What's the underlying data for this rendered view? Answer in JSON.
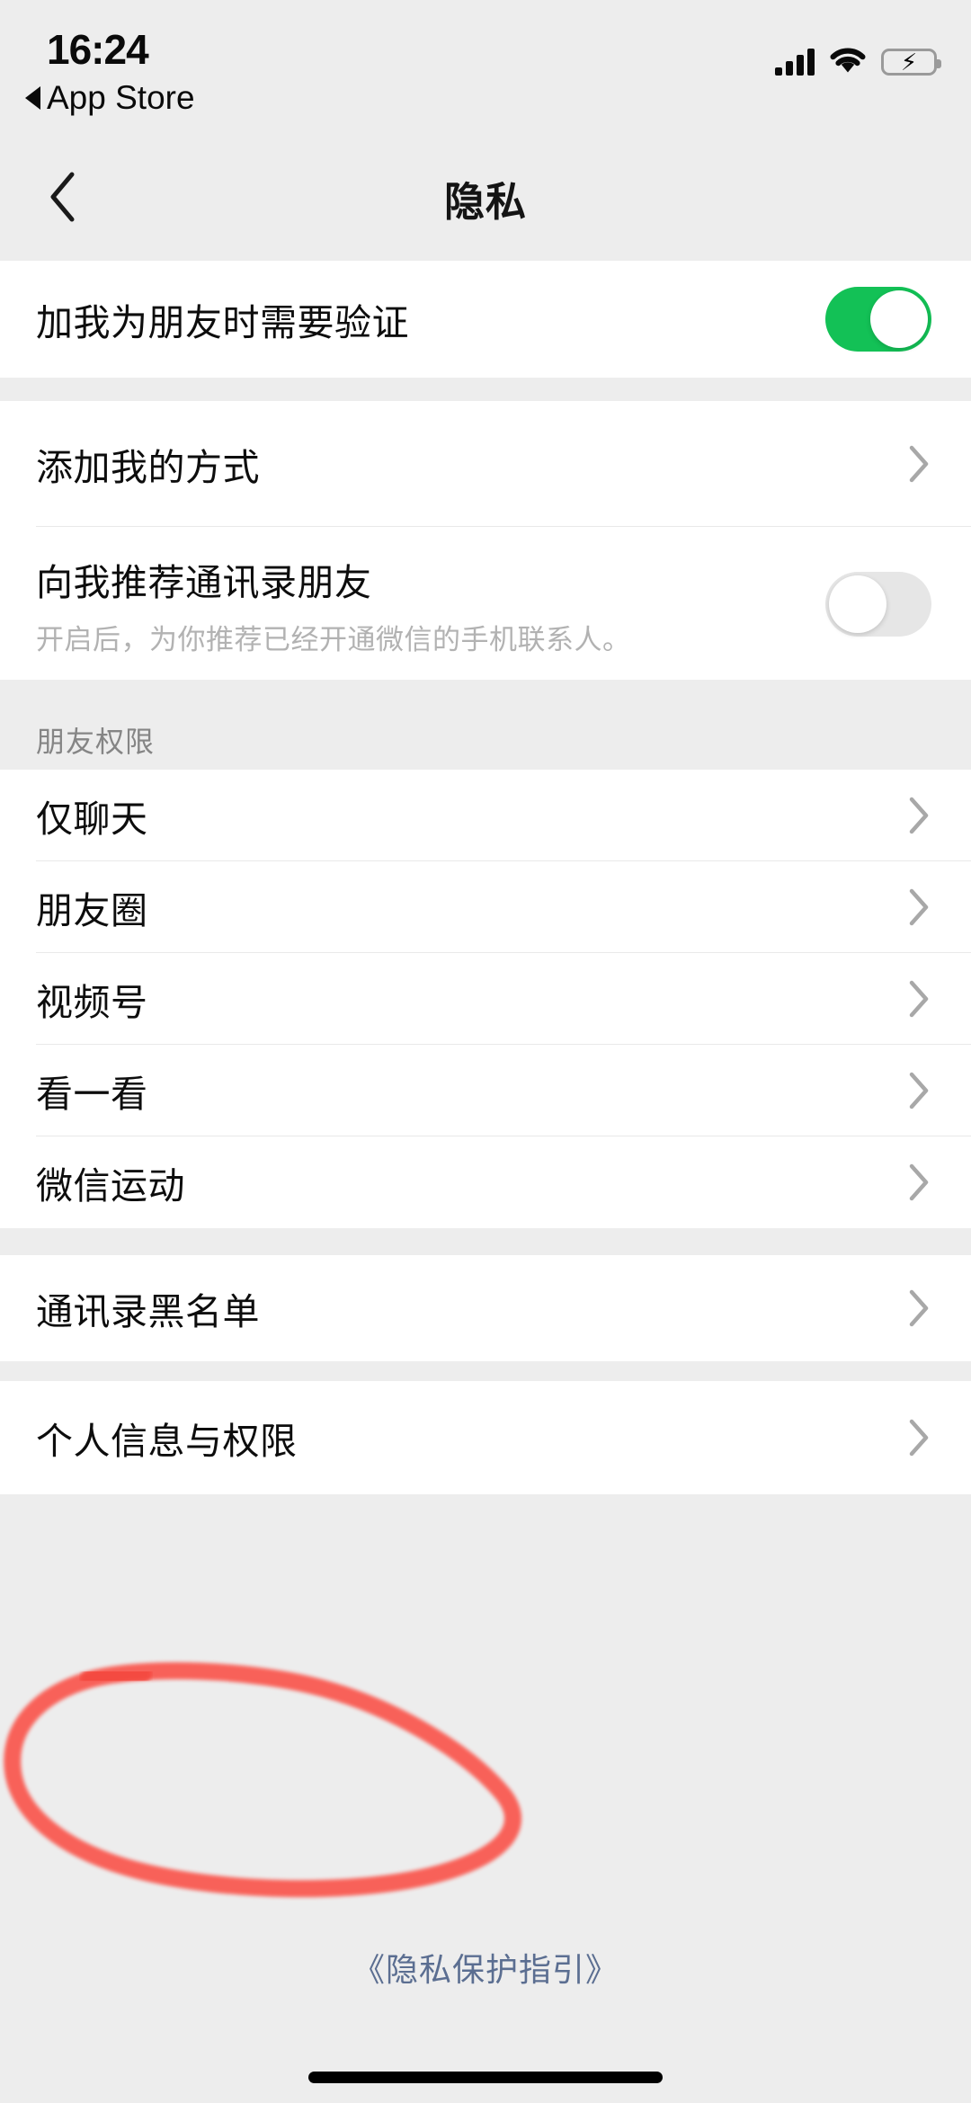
{
  "status_bar": {
    "time": "16:24",
    "back_to_app": "App Store",
    "signal_icon": "cellular-signal-icon",
    "wifi_icon": "wifi-icon",
    "battery_icon": "battery-charging-icon"
  },
  "nav": {
    "back_icon": "chevron-left-icon",
    "title": "隐私"
  },
  "sections": [
    {
      "header": "",
      "rows": [
        {
          "label": "加我为朋友时需要验证",
          "sub": "",
          "control": "switch",
          "switch_on": true
        }
      ]
    },
    {
      "header": "",
      "rows": [
        {
          "label": "添加我的方式",
          "sub": "",
          "control": "chevron"
        },
        {
          "label": "向我推荐通讯录朋友",
          "sub": "开启后，为你推荐已经开通微信的手机联系人。",
          "control": "switch",
          "switch_on": false
        }
      ]
    },
    {
      "header": "朋友权限",
      "rows": [
        {
          "label": "仅聊天",
          "sub": "",
          "control": "chevron"
        },
        {
          "label": "朋友圈",
          "sub": "",
          "control": "chevron"
        },
        {
          "label": "视频号",
          "sub": "",
          "control": "chevron"
        },
        {
          "label": "看一看",
          "sub": "",
          "control": "chevron"
        },
        {
          "label": "微信运动",
          "sub": "",
          "control": "chevron"
        }
      ]
    },
    {
      "header": "",
      "rows": [
        {
          "label": "通讯录黑名单",
          "sub": "",
          "control": "chevron"
        }
      ]
    },
    {
      "header": "",
      "rows": [
        {
          "label": "个人信息与权限",
          "sub": "",
          "control": "chevron"
        }
      ]
    }
  ],
  "footer": {
    "link_text": "《隐私保护指引》"
  },
  "annotation": {
    "type": "hand-drawn-red-circle",
    "target_label": "个人信息与权限",
    "color": "#F95C52"
  },
  "colors": {
    "page_background": "#EDEDED",
    "card_background": "#FFFFFF",
    "switch_on": "#13C156",
    "switch_off": "#E6E6E6",
    "footer_link": "#5B6E91",
    "annotation_red": "#F95C52",
    "separator": "#E9E9E9",
    "secondary_text": "#B2B2B2",
    "section_header_text": "#858585"
  }
}
